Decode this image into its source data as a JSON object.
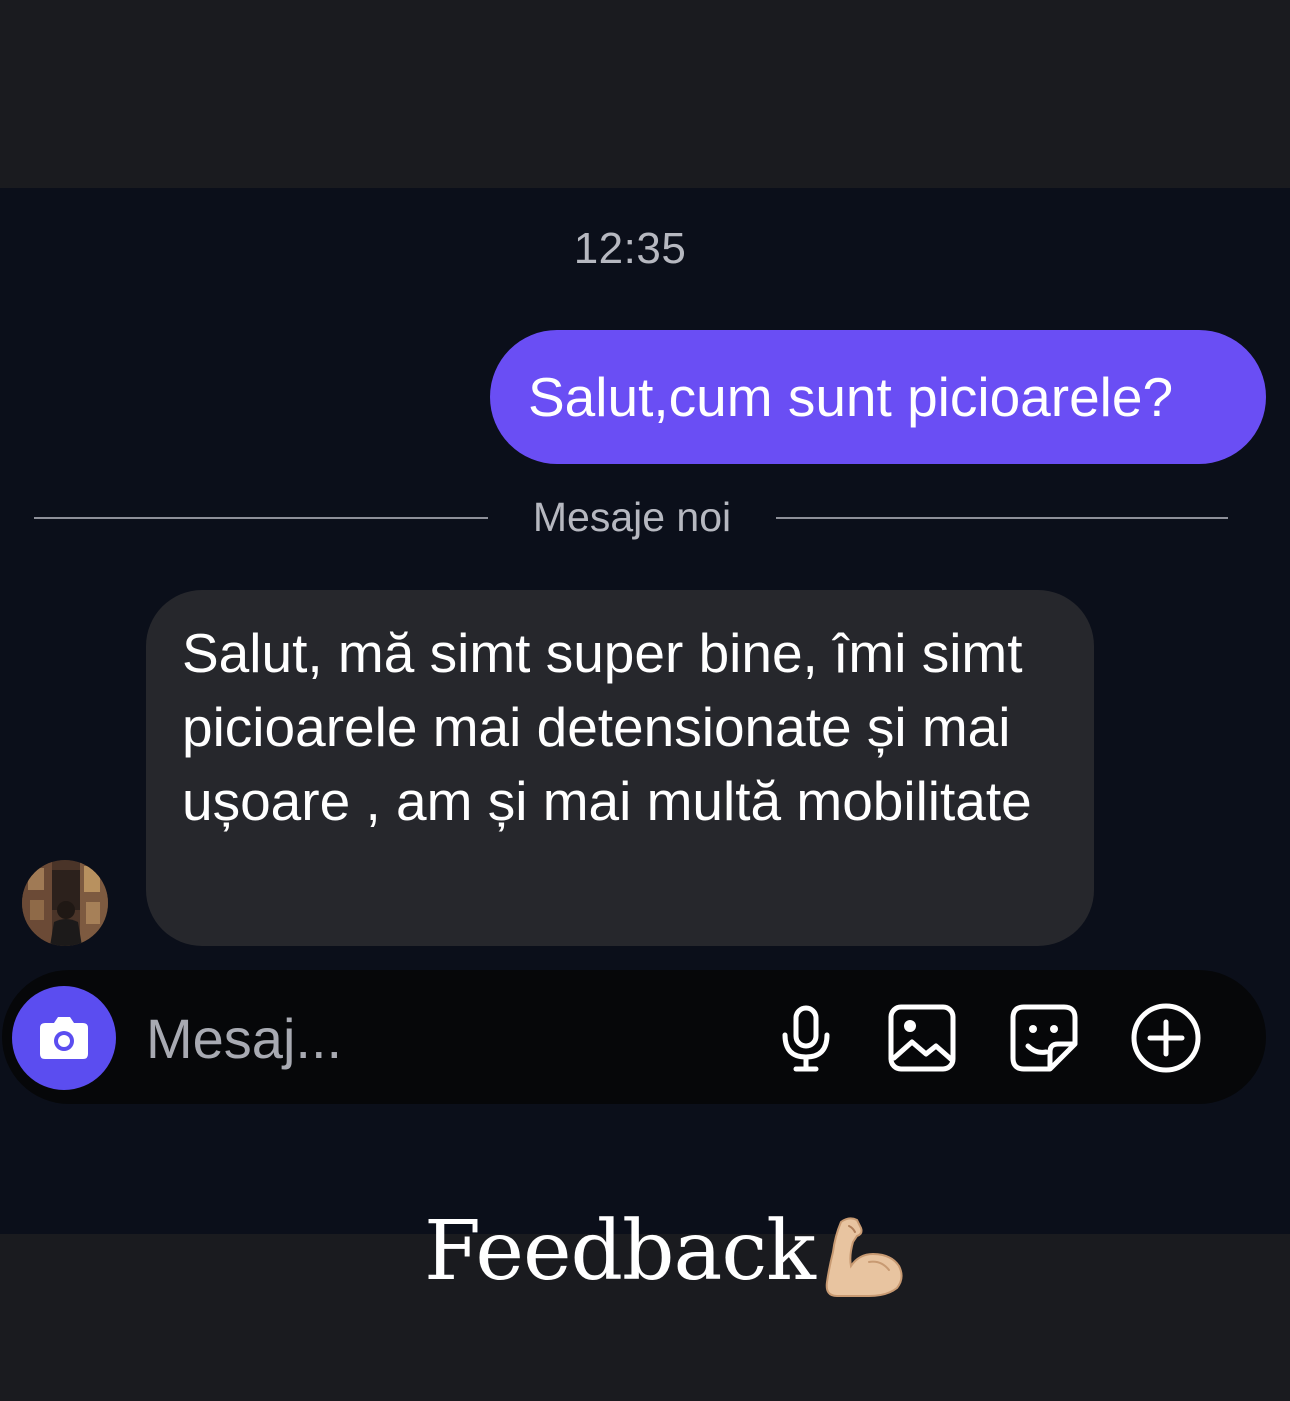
{
  "chat": {
    "timestamp": "12:35",
    "sent_message": "Salut,cum sunt picioarele?",
    "divider_label": "Mesaje noi",
    "received_message": "Salut, mă simt super bine, îmi simt picioarele mai detensionate și mai ușoare , am și mai multă mobilitate"
  },
  "composer": {
    "placeholder": "Mesaj...",
    "icons": [
      "camera-icon",
      "microphone-icon",
      "gallery-icon",
      "sticker-icon",
      "plus-icon"
    ]
  },
  "caption": {
    "text": "Feedback",
    "emoji": "flexed-biceps"
  },
  "colors": {
    "sent_bubble": "#6a4ef4",
    "received_bubble": "#26272c",
    "chat_background": "#0b0f1a",
    "camera_button": "#5b4df0"
  }
}
